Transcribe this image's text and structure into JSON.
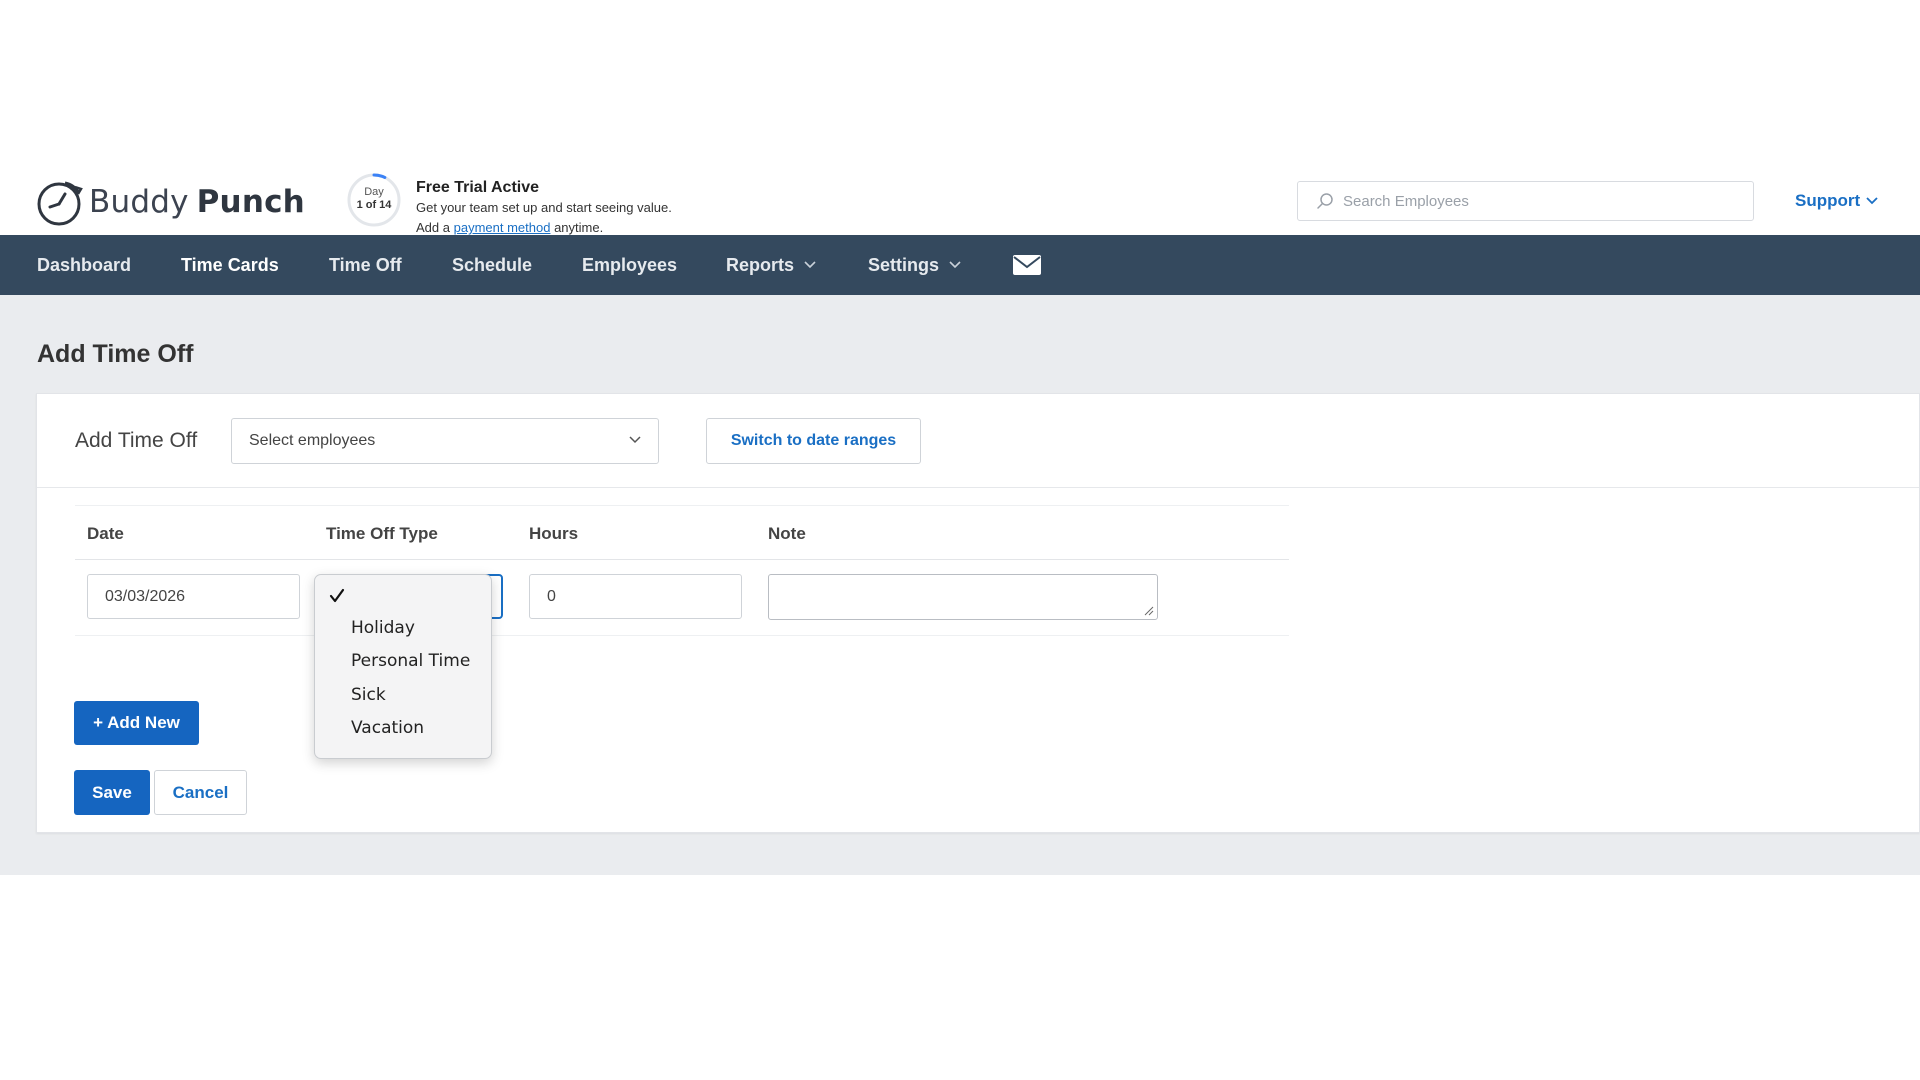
{
  "brand": {
    "name_light": "Buddy",
    "name_bold": "Punch",
    "logo_icon": "stopwatch-icon"
  },
  "trial": {
    "day_label": "Day",
    "day_count": "1 of 14",
    "progress": 0.0714,
    "title": "Free Trial Active",
    "line1": "Get your team set up and start seeing value.",
    "line2_prefix": "Add a",
    "line2_link": "payment method",
    "line2_suffix": "anytime.",
    "accent": "#3b82f6"
  },
  "search": {
    "placeholder": "Search Employees",
    "icon": "search-icon"
  },
  "support": {
    "label": "Support",
    "icon": "chevron-down-icon"
  },
  "nav": {
    "items": [
      {
        "label": "Dashboard"
      },
      {
        "label": "Time Cards",
        "active": true
      },
      {
        "label": "Time Off"
      },
      {
        "label": "Schedule"
      },
      {
        "label": "Employees"
      },
      {
        "label": "Reports",
        "dropdown": true
      },
      {
        "label": "Settings",
        "dropdown": true
      }
    ],
    "mail_icon": "envelope-icon",
    "background": "#34495e"
  },
  "page": {
    "title": "Add Time Off"
  },
  "form": {
    "header_title": "Add Time Off",
    "select_employees_placeholder": "Select employees",
    "switch_button": "Switch to date ranges",
    "columns": [
      "Date",
      "Time Off Type",
      "Hours",
      "Note"
    ],
    "row": {
      "date": "03/03/2026",
      "time_off_type": "",
      "hours": "0",
      "note": ""
    },
    "add_new_button": "+ Add New",
    "save_button": "Save",
    "cancel_button": "Cancel",
    "primary_color": "#1565c0"
  },
  "dropdown": {
    "selected_index": 0,
    "options": [
      "",
      "Holiday",
      "Personal Time",
      "Sick",
      "Vacation"
    ]
  }
}
